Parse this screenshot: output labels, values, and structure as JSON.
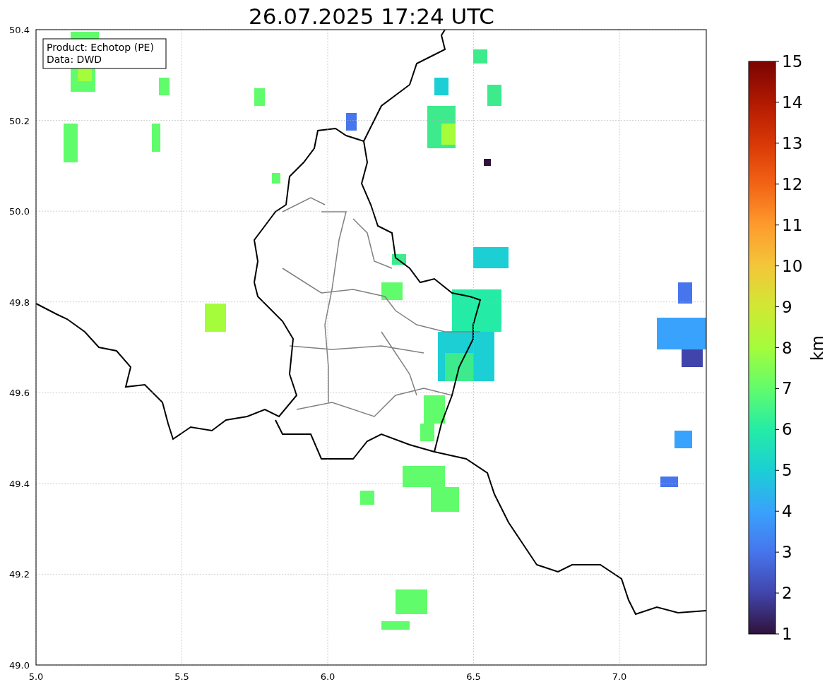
{
  "title": "26.07.2025 17:24 UTC",
  "info_box": [
    "Product: Echotop (PE)",
    "Data: DWD"
  ],
  "x_axis": {
    "ticks": [
      "5.0",
      "5.5",
      "6.0",
      "6.5",
      "7.0"
    ]
  },
  "y_axis": {
    "ticks": [
      "50.4",
      "50.2",
      "50.0",
      "49.8",
      "49.6",
      "49.4",
      "49.2",
      "49.0"
    ]
  },
  "colorbar": {
    "label": "km",
    "ticks": [
      "15",
      "14",
      "13",
      "12",
      "11",
      "10",
      "9",
      "8",
      "7",
      "6",
      "5",
      "4",
      "3",
      "2",
      "1"
    ]
  }
}
